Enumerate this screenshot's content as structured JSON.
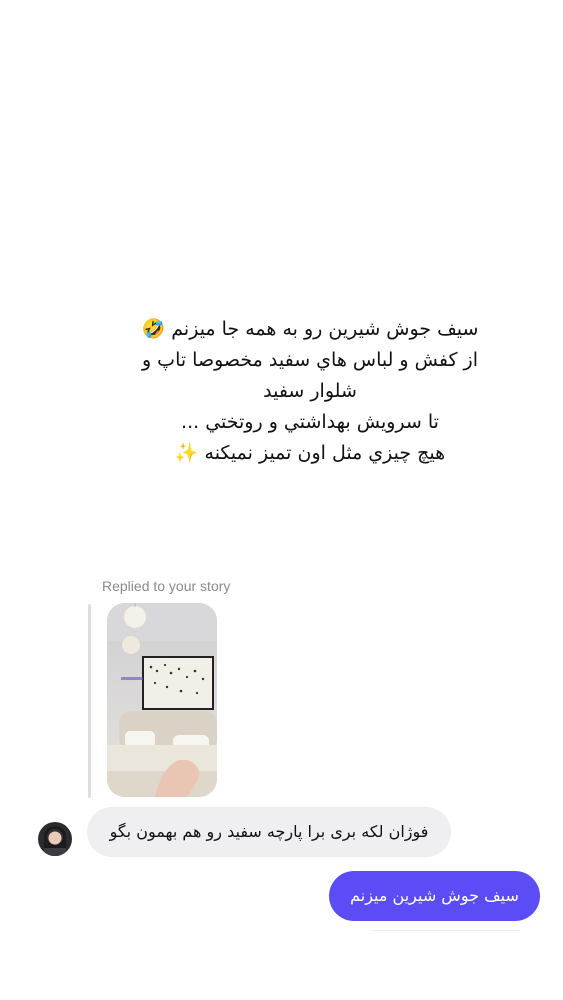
{
  "story": {
    "caption": "سيف جوش شيرين رو به همه جا ميزنم 🤣\nاز كفش و لباس هاي سفيد مخصوصا تاپ و\nشلوار سفيد\nتا سرويش بهداشتي و روتختي ...\nهيچ چيزي مثل اون تميز نميكنه ✨"
  },
  "reply": {
    "label": "Replied to your story"
  },
  "messages": {
    "incoming": "فوژان لكه برى برا پارچه سفيد رو هم بهمون بگو",
    "outgoing": "سيف جوش شيرين ميزنم"
  },
  "colors": {
    "outgoing_bubble": "#5b4cf5",
    "incoming_bubble": "#efeff1",
    "label_gray": "#8a8a8f"
  },
  "icons": {
    "avatar": "user-avatar-photo",
    "story_thumbnail": "bedroom-photo-thumbnail"
  }
}
